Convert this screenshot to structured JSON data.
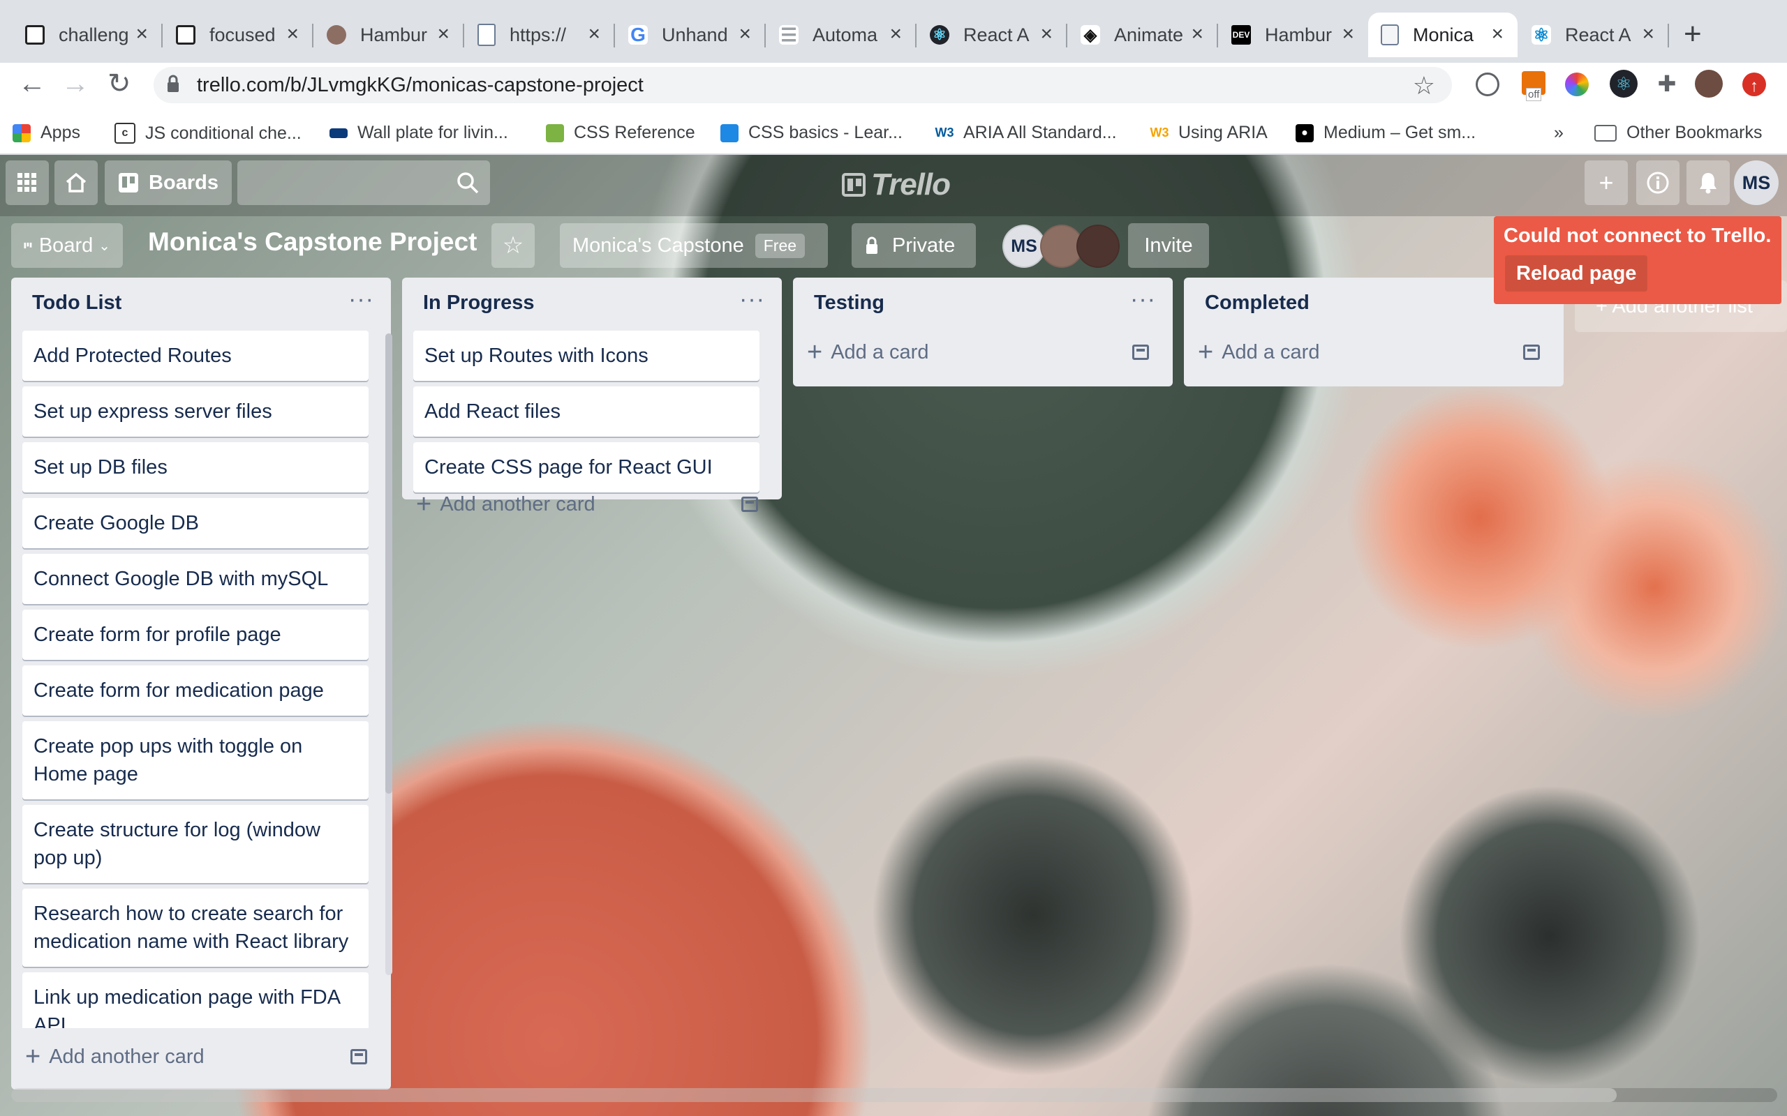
{
  "browser": {
    "tabs": [
      {
        "title": "challeng",
        "icon": "codesandbox-icon"
      },
      {
        "title": "focused",
        "icon": "codesandbox-icon"
      },
      {
        "title": "Hambur",
        "icon": "profile-photo-icon"
      },
      {
        "title": "https://",
        "icon": "document-icon"
      },
      {
        "title": "Unhand",
        "icon": "google-icon"
      },
      {
        "title": "Automa",
        "icon": "list-icon"
      },
      {
        "title": "React A",
        "icon": "react-icon"
      },
      {
        "title": "Animate",
        "icon": "codepen-icon"
      },
      {
        "title": "Hambur",
        "icon": "dev-icon"
      },
      {
        "title": "Monica",
        "icon": "trello-icon"
      },
      {
        "title": "React A",
        "icon": "react-icon"
      }
    ],
    "url": "trello.com/b/JLvmgkKG/monicas-capstone-project",
    "extension_badge": "off",
    "bookmarks": [
      "Apps",
      "JS conditional che...",
      "Wall plate for livin...",
      "CSS Reference",
      "CSS basics - Lear...",
      "ARIA All Standard...",
      "Using ARIA",
      "Medium – Get sm..."
    ],
    "bookmarks_overflow": "»",
    "other_bookmarks": "Other Bookmarks"
  },
  "header": {
    "boards_label": "Boards",
    "logo_text": "Trello",
    "user_initials": "MS"
  },
  "board": {
    "view_label": "Board",
    "title": "Monica's Capstone Project",
    "workspace": "Monica's Capstone",
    "plan_badge": "Free",
    "visibility": "Private",
    "members": [
      "MS"
    ],
    "invite_label": "Invite"
  },
  "error": {
    "message": "Could not connect to Trello.",
    "reload_label": "Reload page"
  },
  "add_list_label": "+ Add another list",
  "lists": [
    {
      "title": "Todo List",
      "cards": [
        "Add Protected Routes",
        "Set up express server files",
        "Set up DB files",
        "Create Google DB",
        "Connect Google DB with mySQL",
        "Create form for profile page",
        "Create form for medication page",
        "Create pop ups with toggle on Home page",
        "Create structure for log (window pop up)",
        "Research how to create search for medication name with React library",
        "Link up medication page with FDA API"
      ],
      "add_label": "Add another card"
    },
    {
      "title": "In Progress",
      "cards": [
        "Set up Routes with Icons",
        "Add React files",
        "Create CSS page for React GUI"
      ],
      "add_label": "Add another card"
    },
    {
      "title": "Testing",
      "cards": [],
      "add_label": "Add a card"
    },
    {
      "title": "Completed",
      "cards": [],
      "add_label": "Add a card"
    }
  ]
}
